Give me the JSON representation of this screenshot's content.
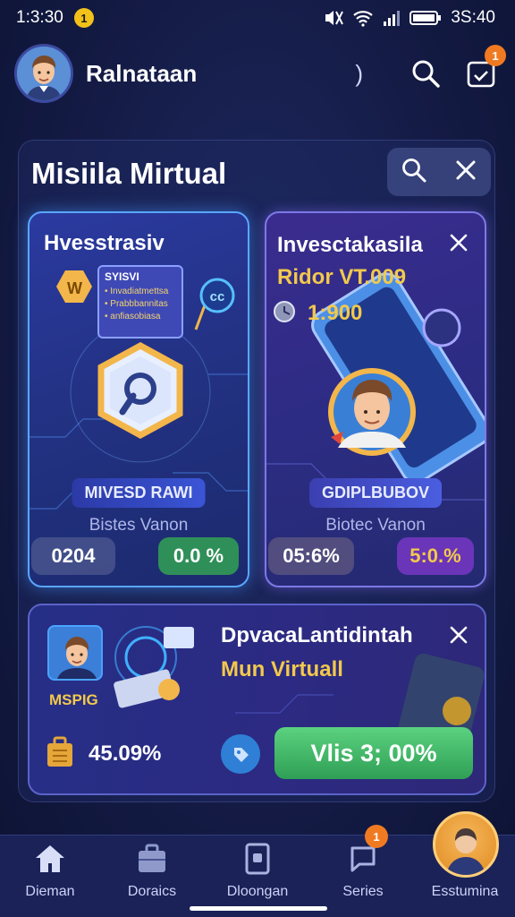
{
  "status_bar": {
    "time": "1:3:30",
    "notif_badge": "1",
    "clock_right": "3S:40"
  },
  "header": {
    "username": "Ralnataan",
    "paren": ")",
    "badge_count": "1"
  },
  "panel": {
    "title": "Misiila Mirtual"
  },
  "card_left": {
    "title": "Hvesstrasiv",
    "mini_card_title": "SYISVI",
    "mini_card_lines": [
      "• Invadiatmettsa",
      "• Prabbbannitas",
      "• anfiasobiasa"
    ],
    "coin_label": "W",
    "button_label": "MIVESD RAWI",
    "caption": "Bistes Vanon",
    "stat_left": "0204",
    "stat_right": "0.0 %"
  },
  "card_right": {
    "title": "Invesctakasila",
    "subtitle": "Ridor VT.009",
    "amount": "1:900",
    "button_label": "GDIPLBUBOV",
    "caption": "Biotec Vanon",
    "stat_left": "05:6%",
    "stat_right": "5:0.%"
  },
  "card_bottom": {
    "title": "DpvacaLantidintah",
    "subtitle": "Mun Virtuall",
    "avatar_label": "MSPIG",
    "stat": "45.09%",
    "action_label": "Vlis 3; 00%"
  },
  "bottom_nav": {
    "items": [
      {
        "label": "Dieman"
      },
      {
        "label": "Doraics"
      },
      {
        "label": "Dloongan"
      },
      {
        "label": "Series",
        "badge": "1"
      },
      {
        "label": "Esstumina"
      }
    ]
  },
  "colors": {
    "accent_blue": "#59a6ff",
    "accent_gold": "#f2c94c",
    "accent_green": "#3fbf6a",
    "badge_orange": "#f07a22"
  },
  "icons": [
    "search-icon",
    "close-icon",
    "calendar-check-icon",
    "home-icon",
    "briefcase-icon",
    "document-icon",
    "chat-icon",
    "wifi-icon",
    "battery-icon"
  ]
}
